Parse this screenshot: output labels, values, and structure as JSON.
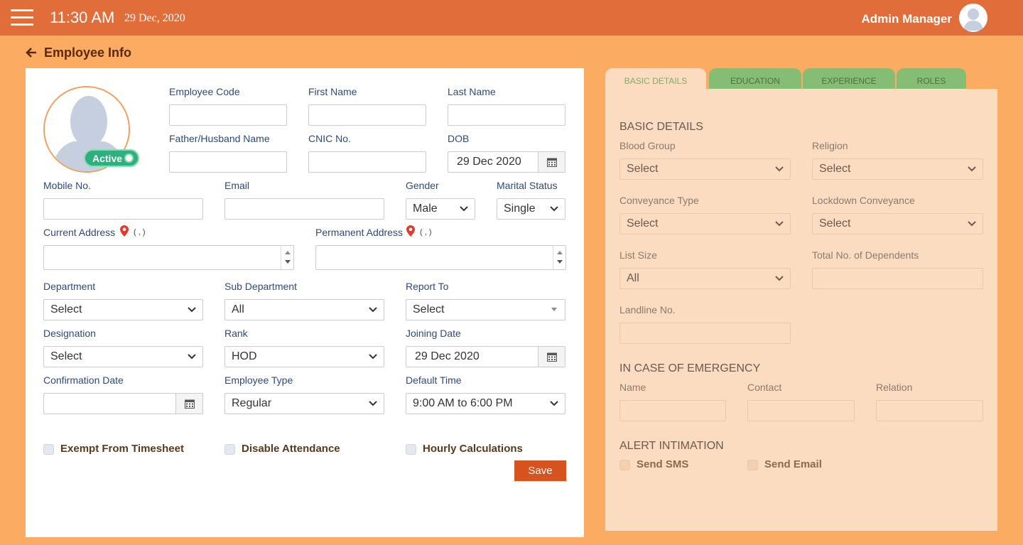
{
  "header": {
    "time": "11:30 AM",
    "date": "29 Dec, 2020",
    "user": "Admin Manager"
  },
  "page": {
    "title": "Employee Info"
  },
  "form": {
    "status": "Active",
    "labels": {
      "employee_code": "Employee Code",
      "first_name": "First Name",
      "last_name": "Last Name",
      "father_name": "Father/Husband Name",
      "cnic": "CNIC No.",
      "dob": "DOB",
      "mobile": "Mobile No.",
      "email": "Email",
      "gender": "Gender",
      "marital": "Marital Status",
      "current_address": "Current Address",
      "permanent_address": "Permanent Address",
      "department": "Department",
      "sub_department": "Sub Department",
      "report_to": "Report To",
      "designation": "Designation",
      "rank": "Rank",
      "joining_date": "Joining Date",
      "confirmation_date": "Confirmation Date",
      "employee_type": "Employee Type",
      "default_time": "Default Time"
    },
    "values": {
      "dob": "29 Dec 2020",
      "gender": "Male",
      "marital": "Single",
      "department": "Select",
      "sub_department": "All",
      "report_to": "Select",
      "designation": "Select",
      "rank": "HOD",
      "joining_date": "29 Dec 2020",
      "employee_type": "Regular",
      "default_time": "9:00 AM to 6:00 PM",
      "current_coords": "( , )",
      "permanent_coords": "( , )"
    },
    "checkboxes": {
      "exempt": "Exempt From Timesheet",
      "disable_attendance": "Disable Attendance",
      "hourly": "Hourly Calculations"
    },
    "save_label": "Save"
  },
  "tabs": [
    "BASIC DETAILS",
    "EDUCATION",
    "EXPERIENCE",
    "ROLES"
  ],
  "panel": {
    "basic_title": "BASIC DETAILS",
    "labels": {
      "blood_group": "Blood Group",
      "religion": "Religion",
      "conveyance": "Conveyance Type",
      "lockdown": "Lockdown Conveyance",
      "list_size": "List Size",
      "dependents": "Total No. of Dependents",
      "landline": "Landline No."
    },
    "values": {
      "blood_group": "Select",
      "religion": "Select",
      "conveyance": "Select",
      "lockdown": "Select",
      "list_size": "All"
    },
    "emergency_title": "IN CASE OF EMERGENCY",
    "emergency_labels": {
      "name": "Name",
      "contact": "Contact",
      "relation": "Relation"
    },
    "alert_title": "ALERT INTIMATION",
    "alert_labels": {
      "sms": "Send SMS",
      "email": "Send Email"
    }
  },
  "colors": {
    "topbar": "#e06d3a",
    "background": "#fbab62",
    "accent": "#d6531f",
    "tab_green": "#86bd75",
    "status_green": "#2eaf7d"
  }
}
